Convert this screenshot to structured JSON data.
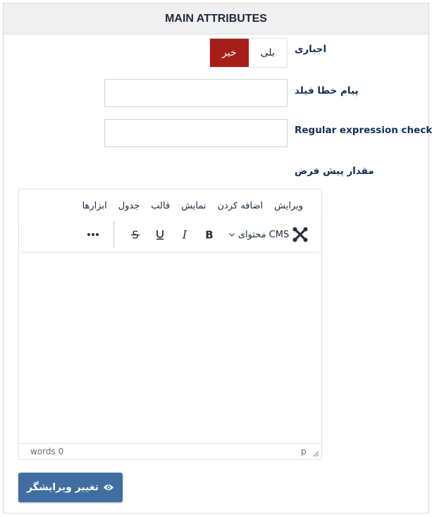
{
  "panel": {
    "title": "MAIN ATTRIBUTES"
  },
  "fields": {
    "required": {
      "label": "اجباری",
      "yes_label": "بلی",
      "no_label": "خیر",
      "selected": "خیر"
    },
    "error_message": {
      "label": "پیام خطا فیلد",
      "value": ""
    },
    "regex": {
      "label": "Regular expression check",
      "value": ""
    },
    "default_value": {
      "label": "مقدار پیش فرض"
    }
  },
  "editor": {
    "menu": [
      "ویرایش",
      "اضافه کردن",
      "نمایش",
      "قالب",
      "جدول",
      "ابزارها"
    ],
    "cms_content_label": "محتوای CMS",
    "icons": [
      "joomla-icon",
      "chevron-down-icon",
      "bold-icon",
      "italic-icon",
      "underline-icon",
      "strikethrough-icon",
      "more-icon"
    ],
    "word_count": "words 0",
    "path": "p"
  },
  "toggle_editor_button": {
    "label": "تغییر ویرایشگر",
    "icon": "eye-icon"
  },
  "colors": {
    "no_active": "#a51f18",
    "button": "#406ea1",
    "label": "#132f55"
  }
}
